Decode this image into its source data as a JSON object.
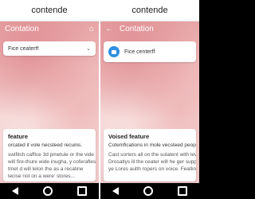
{
  "left": {
    "window_title": "contende",
    "app_title": "Contation",
    "home_icon": "home-icon",
    "search_text": "Fice ceaterff",
    "feature": {
      "title": "feature",
      "subtitle": "orcated it vole necsteed recuins.",
      "lines": [
        "swifitch caffice 3d pmetule or the vide",
        "will fire-thure wide inugha, y coferafles",
        "tmet d will lelon the as a recatine",
        "lecise not on a were' stores..."
      ]
    }
  },
  "right": {
    "window_title": "contende",
    "app_title": "Contation",
    "back_icon": "back-arrow-icon",
    "profile_text": "Fice centerff",
    "feature": {
      "title": "Voised feature",
      "subtitle": "Cotemfications in mole vecsteed peop",
      "lines": [
        "Cast sorters all on the sulatent with leverin",
        "Drosatlys ill the ceater will he ger suppla",
        "ye Lores aulth ropers on voice. Featline"
      ]
    }
  }
}
